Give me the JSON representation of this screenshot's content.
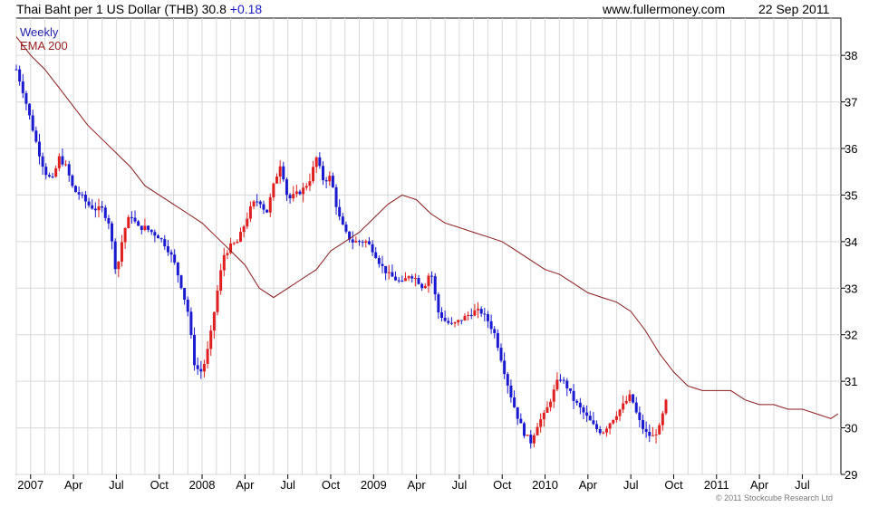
{
  "header": {
    "title": "Thai Baht per 1 US Dollar (THB) 30.8",
    "change": "+0.18",
    "site": "www.fullermoney.com",
    "date": "22 Sep 2011"
  },
  "legend": {
    "weekly": "Weekly",
    "ema": "EMA 200"
  },
  "copyright": "© 2011 Stockcube Research Ltd",
  "colors": {
    "up": "#1a1ad0",
    "down": "#e02020",
    "ema": "#8b1a1a",
    "grid": "#d9d9d9",
    "change": "#1a1ad0"
  },
  "chart_data": {
    "type": "line",
    "title": "Thai Baht per 1 US Dollar (THB)",
    "last_value": 30.8,
    "last_change": 0.18,
    "frequency": "Weekly",
    "ylim": [
      29,
      38.8
    ],
    "y_ticks": [
      29,
      30,
      31,
      32,
      33,
      34,
      35,
      36,
      37,
      38
    ],
    "x_ticks": [
      "2007",
      "Apr",
      "Jul",
      "Oct",
      "2008",
      "Apr",
      "Jul",
      "Oct",
      "2009",
      "Apr",
      "Jul",
      "Oct",
      "2010",
      "Apr",
      "Jul",
      "Oct",
      "2011",
      "Apr",
      "Jul"
    ],
    "x_tick_months": [
      0,
      3,
      6,
      9,
      12,
      15,
      18,
      21,
      24,
      27,
      30,
      33,
      36,
      39,
      42,
      45,
      48,
      51,
      54
    ],
    "x_range_months": [
      -1.0,
      56.7
    ],
    "grid": true,
    "legend_position": "top-left",
    "series": [
      {
        "name": "Weekly",
        "kind": "price",
        "t": [
          -1.0,
          -0.5,
          0.0,
          0.5,
          1.0,
          1.5,
          2.0,
          2.5,
          3.0,
          3.5,
          4.0,
          4.5,
          5.0,
          5.5,
          6.0,
          6.5,
          7.0,
          7.5,
          8.0,
          8.5,
          9.0,
          9.5,
          10.0,
          10.5,
          11.0,
          11.5,
          12.0,
          12.5,
          13.0,
          13.5,
          14.0,
          14.5,
          15.0,
          15.5,
          16.0,
          16.5,
          17.0,
          17.5,
          18.0,
          18.5,
          19.0,
          19.5,
          20.0,
          20.5,
          21.0,
          21.5,
          22.0,
          22.5,
          23.0,
          23.5,
          24.0,
          24.5,
          25.0,
          25.5,
          26.0,
          26.5,
          27.0,
          27.5,
          28.0,
          28.5,
          29.0,
          29.5,
          30.0,
          30.5,
          31.0,
          31.5,
          32.0,
          32.5,
          33.0,
          33.5,
          34.0,
          34.5,
          35.0,
          35.5,
          36.0,
          36.5,
          37.0,
          37.5,
          38.0,
          38.5,
          39.0,
          39.5,
          40.0,
          40.5,
          41.0,
          41.5,
          42.0,
          42.5,
          43.0,
          43.5,
          44.0,
          44.5,
          45.0,
          45.5,
          46.0,
          46.5,
          47.0,
          47.5,
          48.0,
          48.5,
          49.0,
          49.5,
          50.0,
          50.5,
          51.0,
          51.5,
          52.0,
          52.5,
          53.0,
          53.5,
          54.0,
          54.5,
          55.0,
          55.5,
          56.0,
          56.5
        ],
        "values": [
          37.7,
          37.2,
          36.6,
          36.0,
          35.5,
          35.3,
          35.8,
          35.6,
          35.1,
          35.0,
          34.8,
          34.7,
          34.7,
          34.4,
          33.3,
          34.2,
          34.6,
          34.3,
          34.3,
          34.2,
          34.1,
          33.9,
          33.6,
          33.1,
          32.5,
          31.3,
          31.2,
          31.8,
          32.8,
          33.7,
          33.9,
          34.0,
          34.4,
          34.8,
          34.9,
          34.6,
          35.2,
          35.7,
          34.9,
          35.0,
          35.1,
          35.3,
          35.8,
          35.3,
          35.4,
          34.6,
          34.2,
          34.0,
          34.0,
          34.0,
          33.8,
          33.5,
          33.3,
          33.2,
          33.1,
          33.3,
          33.2,
          33.0,
          33.4,
          32.5,
          32.3,
          32.2,
          32.3,
          32.4,
          32.5,
          32.5,
          32.3,
          32.0,
          31.4,
          30.8,
          30.3,
          29.9,
          29.7,
          30.1,
          30.3,
          30.7,
          31.1,
          30.9,
          30.6,
          30.4,
          30.2,
          30.0,
          29.9,
          30.1,
          30.3,
          30.5,
          30.7,
          30.2,
          29.9,
          29.8,
          30.0,
          30.6
        ]
      },
      {
        "name": "EMA 200",
        "kind": "line",
        "t": [
          -1.0,
          0.0,
          1.0,
          2.0,
          3.0,
          4.0,
          5.0,
          6.0,
          7.0,
          8.0,
          9.0,
          10.0,
          11.0,
          12.0,
          13.0,
          14.0,
          15.0,
          16.0,
          17.0,
          18.0,
          19.0,
          20.0,
          21.0,
          22.0,
          23.0,
          24.0,
          25.0,
          26.0,
          27.0,
          28.0,
          29.0,
          30.0,
          31.0,
          32.0,
          33.0,
          34.0,
          35.0,
          36.0,
          37.0,
          38.0,
          39.0,
          40.0,
          41.0,
          42.0,
          43.0,
          44.0,
          45.0,
          46.0,
          47.0,
          48.0,
          49.0,
          50.0,
          51.0,
          52.0,
          53.0,
          54.0,
          55.0,
          56.0,
          56.5
        ],
        "values": [
          38.4,
          38.0,
          37.7,
          37.3,
          36.9,
          36.5,
          36.2,
          35.9,
          35.6,
          35.2,
          35.0,
          34.8,
          34.6,
          34.4,
          34.1,
          33.8,
          33.5,
          33.0,
          32.8,
          33.0,
          33.2,
          33.4,
          33.8,
          34.0,
          34.2,
          34.5,
          34.8,
          35.0,
          34.9,
          34.6,
          34.4,
          34.3,
          34.2,
          34.1,
          34.0,
          33.8,
          33.6,
          33.4,
          33.3,
          33.1,
          32.9,
          32.8,
          32.7,
          32.5,
          32.1,
          31.6,
          31.2,
          30.9,
          30.8,
          30.8,
          30.8,
          30.6,
          30.5,
          30.5,
          30.4,
          30.4,
          30.3,
          30.2,
          30.3
        ]
      }
    ]
  }
}
